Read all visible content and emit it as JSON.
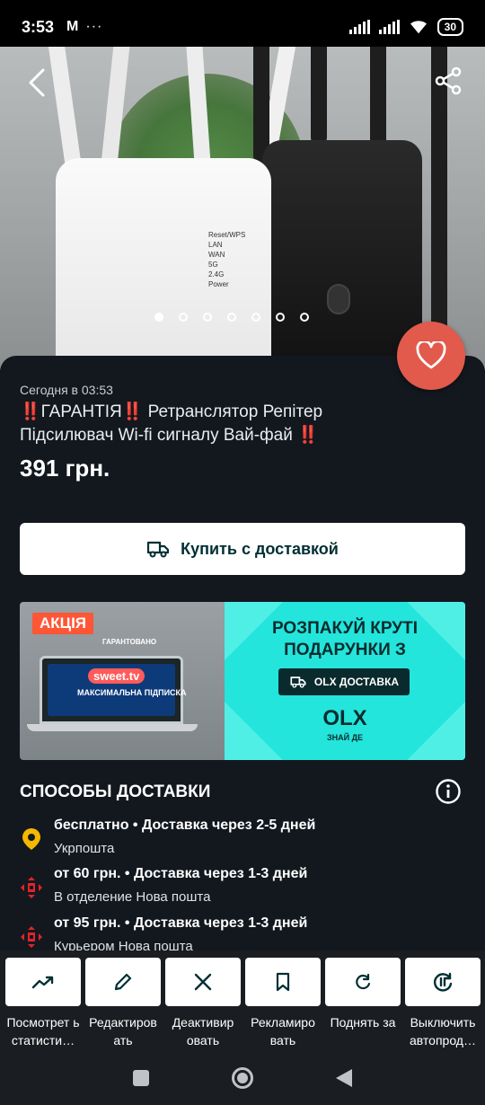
{
  "status_bar": {
    "time": "3:53",
    "mail_glyph": "M",
    "dots": "···",
    "battery": "30"
  },
  "hero": {
    "router_leds": [
      "Reset/WPS",
      "LAN",
      "WAN",
      "5G",
      "2.4G",
      "Power"
    ],
    "carousel": {
      "count": 7,
      "active_index": 0
    }
  },
  "listing": {
    "date": "Сегодня в 03:53",
    "title": "‼️ГАРАНТІЯ‼️ Ретранслятор Репітер Підсилювач Wi-fi сигналу Вай-фай ‼️",
    "price": "391 грн."
  },
  "buy_button": {
    "label": "Купить с доставкой"
  },
  "banner": {
    "badge": "АКЦІЯ",
    "guarantee": "ГАРАНТОВАНО",
    "brand": "sweet.tv",
    "subscription": "МАКСИМАЛЬНА ПІДПИСКА",
    "headline_1": "РОЗПАКУЙ КРУТІ",
    "headline_2": "ПОДАРУНКИ З",
    "delivery_pill": "OLX ДОСТАВКА",
    "logo": "OLX",
    "slogan": "ЗНАЙ ДЕ",
    "colors": {
      "accent": "#23e5db",
      "dark": "#0a2b2e",
      "badge": "#ff5636"
    }
  },
  "delivery": {
    "heading": "СПОСОБЫ ДОСТАВКИ",
    "items": [
      {
        "line1": "бесплатно • Доставка через 2-5 дней",
        "line2": "Укрпошта",
        "icon": "ukrposhta-icon"
      },
      {
        "line1": "от 60 грн. • Доставка через 1-3 дней",
        "line2": "В отделение Нова пошта",
        "icon": "nova-poshta-icon"
      },
      {
        "line1": "от 95 грн. • Доставка через 1-3 дней",
        "line2": "Курьером Нова пошта",
        "icon": "nova-poshta-icon"
      }
    ]
  },
  "actions": [
    {
      "label": "Посмотрет ь статисти…",
      "icon": "trending-up-icon"
    },
    {
      "label": "Редактиров ать",
      "icon": "pencil-icon"
    },
    {
      "label": "Деактивир овать",
      "icon": "close-icon"
    },
    {
      "label": "Рекламиро вать",
      "icon": "bookmark-icon"
    },
    {
      "label": "Поднять за",
      "icon": "refresh-icon"
    },
    {
      "label": "Выключить автопрод…",
      "icon": "auto-renew-off-icon"
    }
  ],
  "theme": {
    "card_bg": "#13181f",
    "favorite": "#e15a4c"
  }
}
